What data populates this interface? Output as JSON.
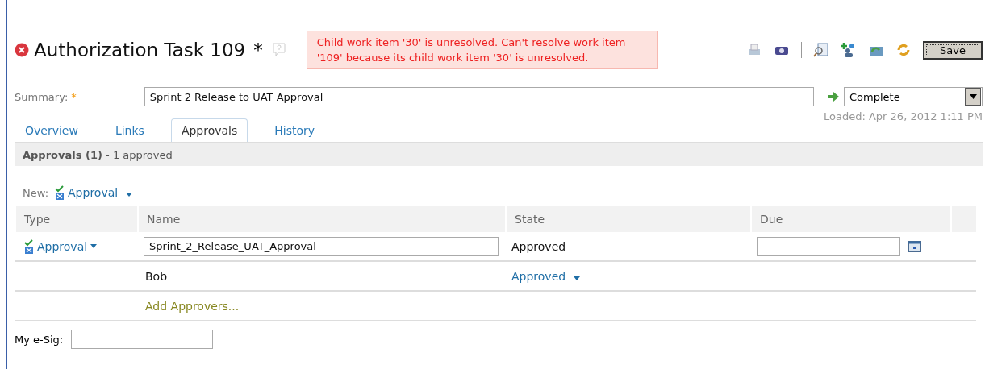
{
  "header": {
    "title": "Authorization Task 109",
    "dirty_mark": "*",
    "error": "Child work item '30' is unresolved. Can't resolve work item '109' because its child work item '30' is unresolved.",
    "save_button": "Save"
  },
  "summary": {
    "label": "Summary:",
    "required_mark": "*",
    "value": "Sprint 2 Release to UAT Approval"
  },
  "workflow": {
    "action": "Complete",
    "loaded": "Loaded: Apr 26, 2012 1:11 PM"
  },
  "tabs": [
    {
      "label": "Overview",
      "selected": false
    },
    {
      "label": "Links",
      "selected": false
    },
    {
      "label": "Approvals",
      "selected": true
    },
    {
      "label": "History",
      "selected": false
    }
  ],
  "section": {
    "title": "**Approvals (1)** - 1 approved"
  },
  "new": {
    "label": "New:",
    "link": "Approval"
  },
  "table": {
    "columns": [
      "Type",
      "Name",
      "State",
      "Due"
    ],
    "rows": [
      {
        "kind": "approval",
        "type": "Approval",
        "name": "Sprint_2_Release_UAT_Approval",
        "state": "Approved"
      },
      {
        "kind": "approver",
        "name": "Bob",
        "state": "Approved"
      },
      {
        "kind": "add",
        "name": "Add Approvers..."
      }
    ]
  },
  "esig": {
    "label": "My e-Sig:"
  }
}
